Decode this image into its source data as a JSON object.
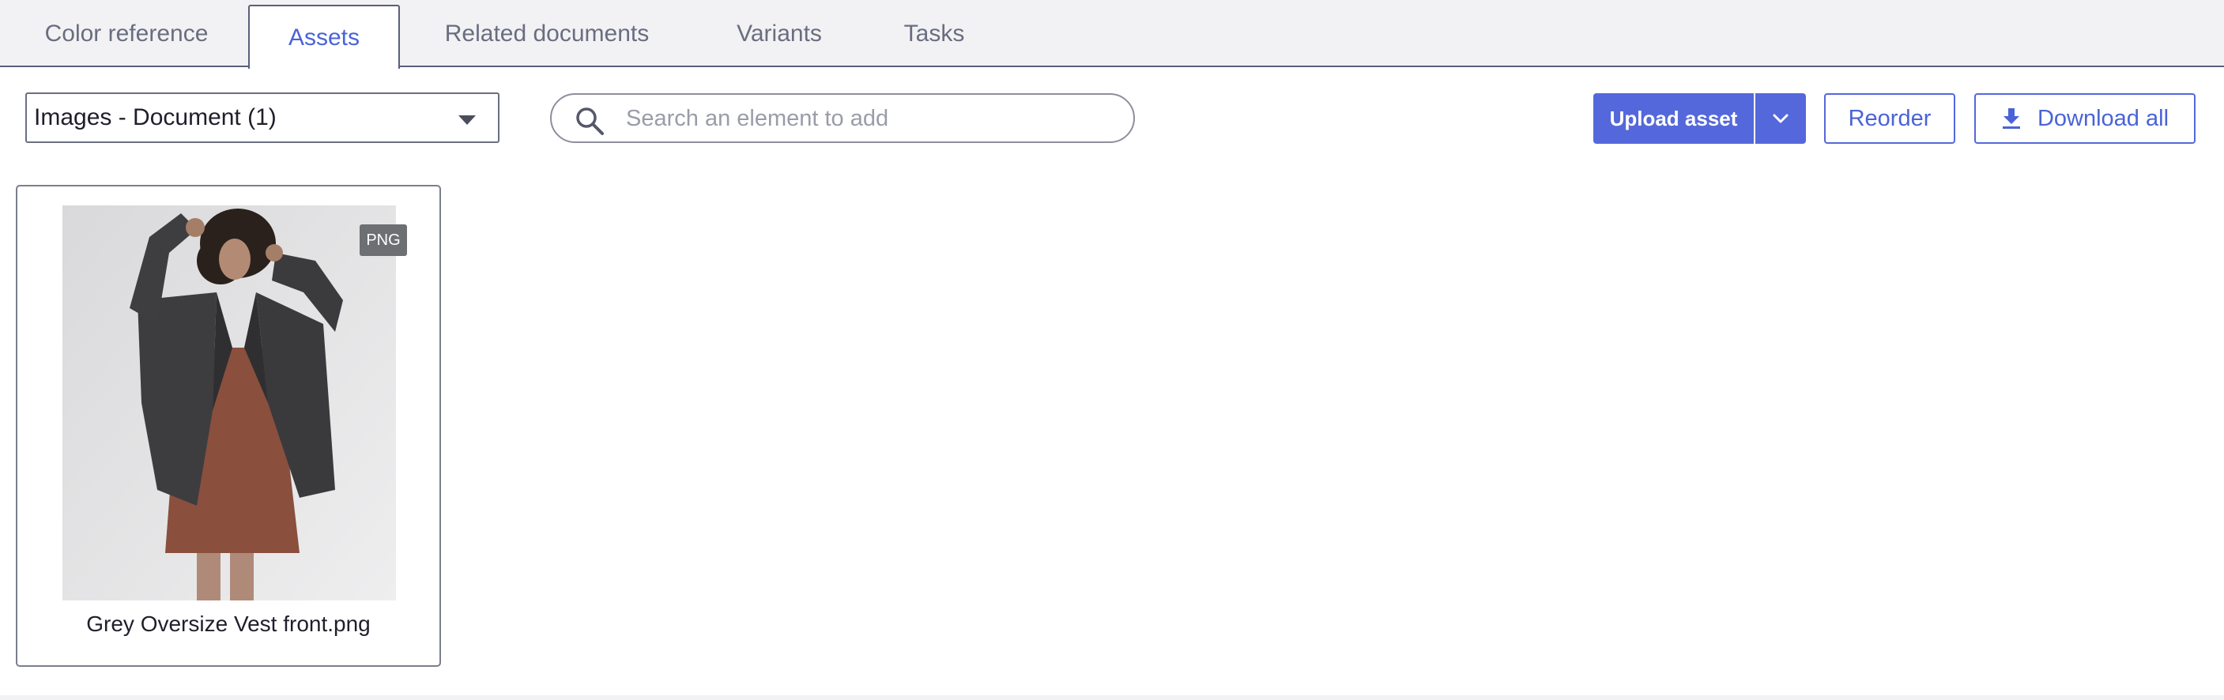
{
  "tabs": [
    {
      "label": "Color reference",
      "active": false
    },
    {
      "label": "Assets",
      "active": true
    },
    {
      "label": "Related documents",
      "active": false
    },
    {
      "label": "Variants",
      "active": false
    },
    {
      "label": "Tasks",
      "active": false
    }
  ],
  "toolbar": {
    "filter_select_value": "Images - Document (1)",
    "search_placeholder": "Search an element to add",
    "upload_label": "Upload asset",
    "reorder_label": "Reorder",
    "download_all_label": "Download all"
  },
  "assets": [
    {
      "file_type": "PNG",
      "name": "Grey Oversize Vest front.png"
    }
  ],
  "colors": {
    "accent": "#5468db",
    "tab_active_text": "#4a63d6",
    "tabbar_bg": "#f2f2f4",
    "badge_bg": "#6e6f73"
  },
  "icons": {
    "search": "search-icon",
    "select_caret": "caret-down-icon",
    "upload_menu": "chevron-down-icon",
    "download": "download-icon"
  }
}
